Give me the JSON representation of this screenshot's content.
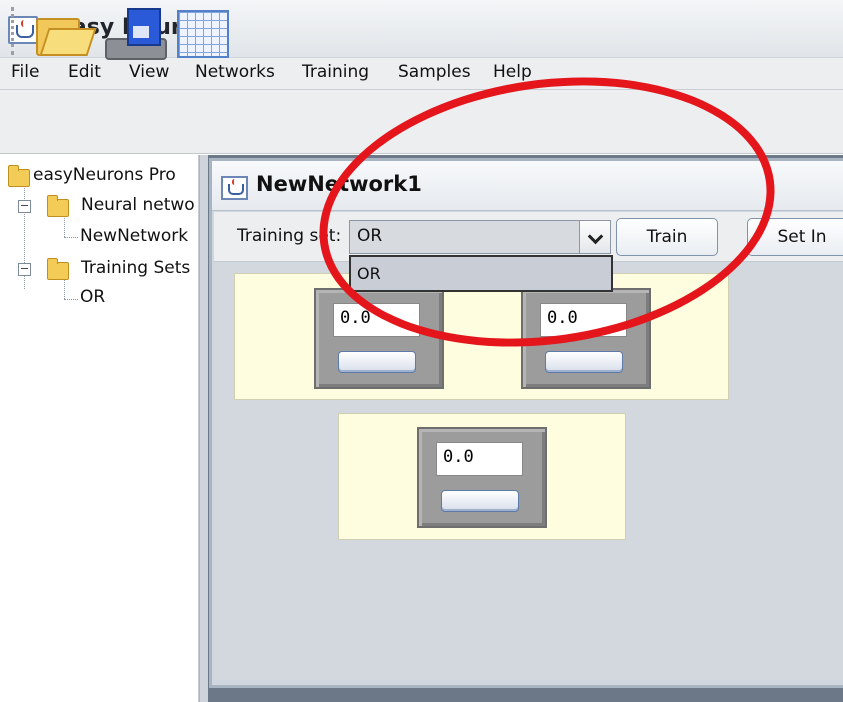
{
  "app": {
    "title": "easy Neurons"
  },
  "menu": {
    "items": [
      "File",
      "Edit",
      "View",
      "Networks",
      "Training",
      "Samples",
      "Help"
    ]
  },
  "toolbar": {
    "icons": [
      "open-folder-icon",
      "save-disk-icon",
      "table-icon"
    ]
  },
  "tree": {
    "root": "easyNeurons Pro",
    "neural_networks": "Neural netwo",
    "network_item": "NewNetwork",
    "training_sets": "Training Sets",
    "training_item": "OR"
  },
  "network_window": {
    "title": "NewNetwork1",
    "training_set_label": "Training set:",
    "training_set_value": "OR",
    "dropdown_options": [
      "OR"
    ],
    "train_button": "Train",
    "set_input_button": "Set In"
  },
  "neurons": {
    "input_1": "0.0",
    "input_2": "0.0",
    "output_1": "0.0"
  },
  "colors": {
    "highlight": "#e4161c",
    "layer_background": "#fffde0",
    "neuron_gray": "#9c9c9c"
  }
}
